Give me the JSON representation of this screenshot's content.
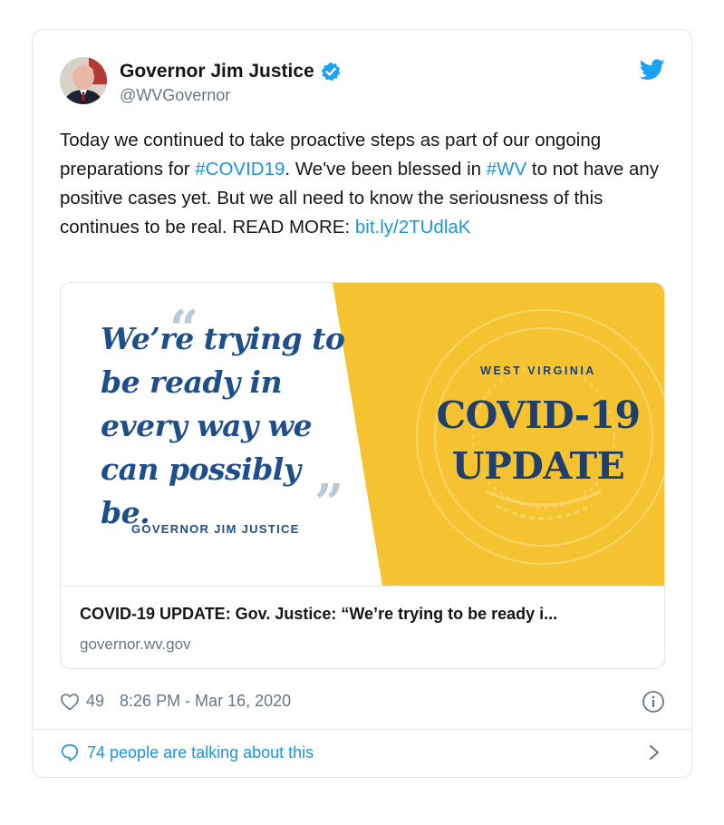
{
  "author": {
    "name": "Governor Jim Justice",
    "handle": "@WVGovernor",
    "verified": true
  },
  "tweet": {
    "segments": [
      {
        "text": "Today we continued to take proactive steps as part of our ongoing preparations for ",
        "type": "text"
      },
      {
        "text": "#COVID19",
        "type": "hashtag"
      },
      {
        "text": ". We've been blessed in ",
        "type": "text"
      },
      {
        "text": "#WV",
        "type": "hashtag"
      },
      {
        "text": " to not have any positive cases yet. But we all need to know the seriousness of this continues to be real. READ MORE: ",
        "type": "text"
      },
      {
        "text": "bit.ly/2TUdlaK",
        "type": "link"
      }
    ]
  },
  "card": {
    "quote": "We’re trying to be ready in every way we can possibly be.",
    "quote_attribution": "GOVERNOR JIM JUSTICE",
    "state_label": "WEST VIRGINIA",
    "update_title_line1": "COVID-19",
    "update_title_line2": "UPDATE",
    "title": "COVID-19 UPDATE: Gov. Justice: “We’re trying to be ready i...",
    "domain": "governor.wv.gov"
  },
  "meta": {
    "likes": "49",
    "timestamp": "8:26 PM - Mar 16, 2020"
  },
  "conversation": {
    "label": "74 people are talking about this"
  },
  "colors": {
    "link": "#1b95e0",
    "banner_yellow": "#f6c330",
    "quote_blue": "#1f4e8c",
    "muted": "#657786",
    "border": "#e1e8ed"
  },
  "icons": [
    "verified-badge-icon",
    "twitter-bird-icon",
    "heart-icon",
    "info-icon",
    "speech-bubble-icon",
    "chevron-right-icon"
  ]
}
